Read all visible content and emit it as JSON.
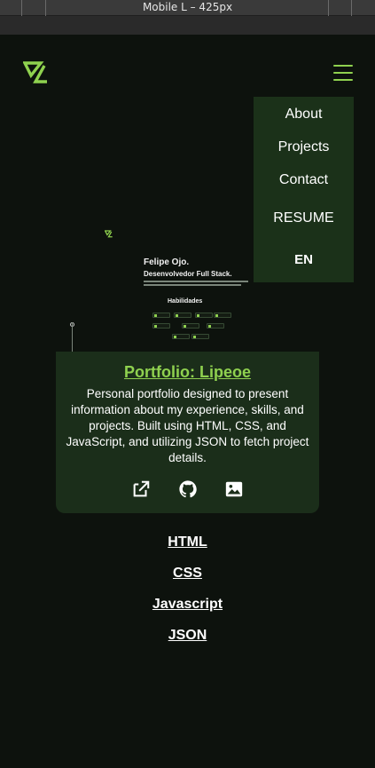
{
  "devtools": {
    "title": "Mobile L – 425px"
  },
  "header": {
    "logo_icon": "lipeoe-logo-icon",
    "menu_icon": "hamburger-menu-icon"
  },
  "menu": {
    "items": [
      "About",
      "Projects",
      "Contact",
      "RESUME"
    ],
    "language": "EN"
  },
  "preview": {
    "name": "Felipe Ojo.",
    "role": "Desenvolvedor Full Stack.",
    "skills_heading": "Habilidades"
  },
  "project": {
    "title": "Portfolio: Lipeoe",
    "description": "Personal portfolio designed to present information about my experience, skills, and projects. Built using HTML, CSS, and JavaScript, and utilizing JSON to fetch project details.",
    "icons": [
      "external-link-icon",
      "github-icon",
      "image-icon"
    ]
  },
  "technologies": [
    "HTML",
    "CSS",
    "Javascript",
    "JSON"
  ],
  "colors": {
    "accent": "#8fd14f",
    "background": "#0d120d",
    "card": "#1b2e1a",
    "menu": "#1b3119"
  }
}
